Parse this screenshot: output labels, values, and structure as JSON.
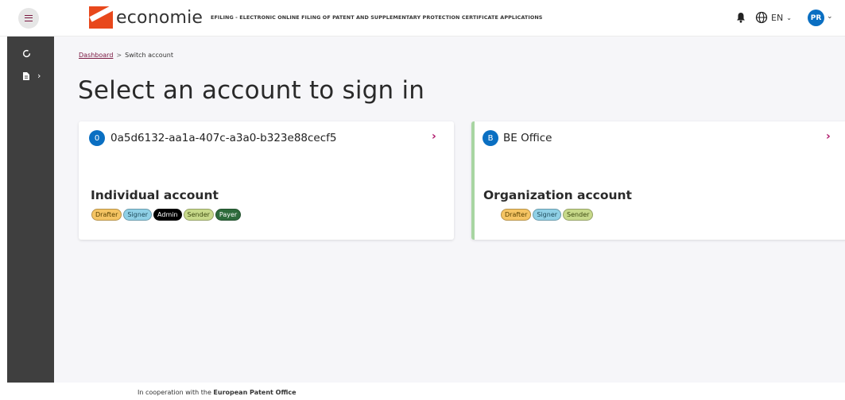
{
  "header": {
    "logo_text": "economie",
    "app_title": "EFILING - ELECTRONIC ONLINE FILING OF PATENT AND SUPPLEMENTARY PROTECTION CERTIFICATE APPLICATIONS",
    "language": "EN",
    "user_initials": "PR"
  },
  "breadcrumb": {
    "home": "Dashboard",
    "separator": ">",
    "current": "Switch account"
  },
  "page_title": "Select an account to sign in",
  "accounts": [
    {
      "badge": "0",
      "name": "0a5d6132-aa1a-407c-a3a0-b323e88cecf5",
      "type": "Individual account",
      "roles": [
        {
          "label": "Drafter",
          "color": "#f5c463"
        },
        {
          "label": "Signer",
          "color": "#8fd0e6"
        },
        {
          "label": "Admin",
          "color": "#000000"
        },
        {
          "label": "Sender",
          "color": "#c7d98a"
        },
        {
          "label": "Payer",
          "color": "#2d6a3b"
        }
      ]
    },
    {
      "badge": "B",
      "name": "BE Office",
      "type": "Organization account",
      "roles": [
        {
          "label": "Drafter",
          "color": "#f5c463"
        },
        {
          "label": "Signer",
          "color": "#8fd0e6"
        },
        {
          "label": "Sender",
          "color": "#c7d98a"
        }
      ]
    }
  ],
  "footer": {
    "prefix": "In cooperation with the",
    "org": "European Patent Office"
  },
  "colors": {
    "accent": "#0a6fc2",
    "link": "#7a1740",
    "arrow": "#b0166a",
    "sidebar": "#3f3f3f"
  }
}
